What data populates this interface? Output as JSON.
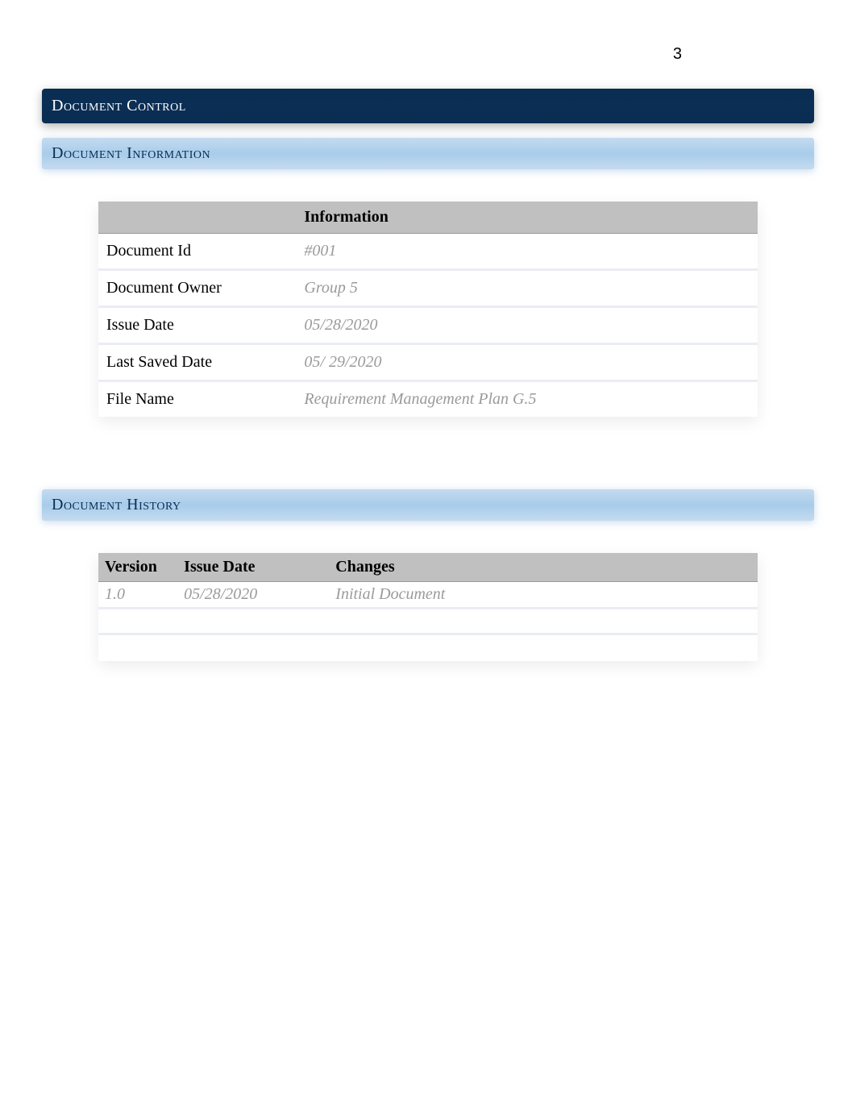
{
  "page_number": "3",
  "headings": {
    "document_control": "Document Control",
    "document_information": "Document Information",
    "document_history": "Document History"
  },
  "info_table": {
    "header_blank": "",
    "header_info": "Information",
    "rows": [
      {
        "label": "Document Id",
        "value": "#001"
      },
      {
        "label": "Document Owner",
        "value": "Group 5"
      },
      {
        "label": "Issue Date",
        "value": "05/28/2020"
      },
      {
        "label": "Last Saved Date",
        "value": "05/ 29/2020"
      },
      {
        "label": "File Name",
        "value": "Requirement Management Plan G.5"
      }
    ]
  },
  "history_table": {
    "headers": {
      "version": "Version",
      "issue_date": "Issue Date",
      "changes": "Changes"
    },
    "rows": [
      {
        "version": "1.0",
        "issue_date": "05/28/2020",
        "changes": "Initial Document"
      },
      {
        "version": "",
        "issue_date": "",
        "changes": ""
      },
      {
        "version": "",
        "issue_date": "",
        "changes": ""
      }
    ]
  }
}
